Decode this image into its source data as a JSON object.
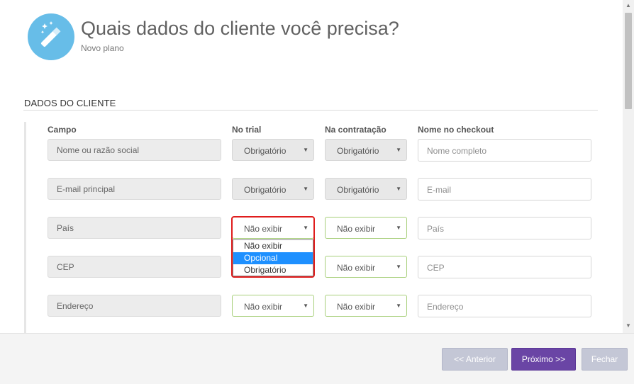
{
  "header": {
    "title": "Quais dados do cliente você precisa?",
    "subtitle": "Novo plano",
    "icon": "magic-wand-icon"
  },
  "section": {
    "title": "DADOS DO CLIENTE"
  },
  "columns": {
    "campo": "Campo",
    "trial": "No trial",
    "contratacao": "Na contratação",
    "checkout": "Nome no checkout"
  },
  "rows": [
    {
      "field": "Nome ou razão social",
      "trial": "Obrigatório",
      "contratacao": "Obrigatório",
      "checkout_placeholder": "Nome completo"
    },
    {
      "field": "E-mail principal",
      "trial": "Obrigatório",
      "contratacao": "Obrigatório",
      "checkout_placeholder": "E-mail"
    },
    {
      "field": "País",
      "trial": "Não exibir",
      "contratacao": "Não exibir",
      "checkout_placeholder": "País"
    },
    {
      "field": "CEP",
      "trial": "",
      "contratacao": "Não exibir",
      "checkout_placeholder": "CEP"
    },
    {
      "field": "Endereço",
      "trial": "Não exibir",
      "contratacao": "Não exibir",
      "checkout_placeholder": "Endereço"
    }
  ],
  "dropdown": {
    "options": [
      "Não exibir",
      "Opcional",
      "Obrigatório"
    ],
    "highlighted": "Opcional"
  },
  "footer": {
    "prev": "<< Anterior",
    "next": "Próximo >>",
    "close": "Fechar"
  },
  "colors": {
    "accent": "#6a45a5",
    "icon_bg": "#67bde8",
    "highlight": "#e01d1d",
    "active_border": "#a7cf7a"
  }
}
